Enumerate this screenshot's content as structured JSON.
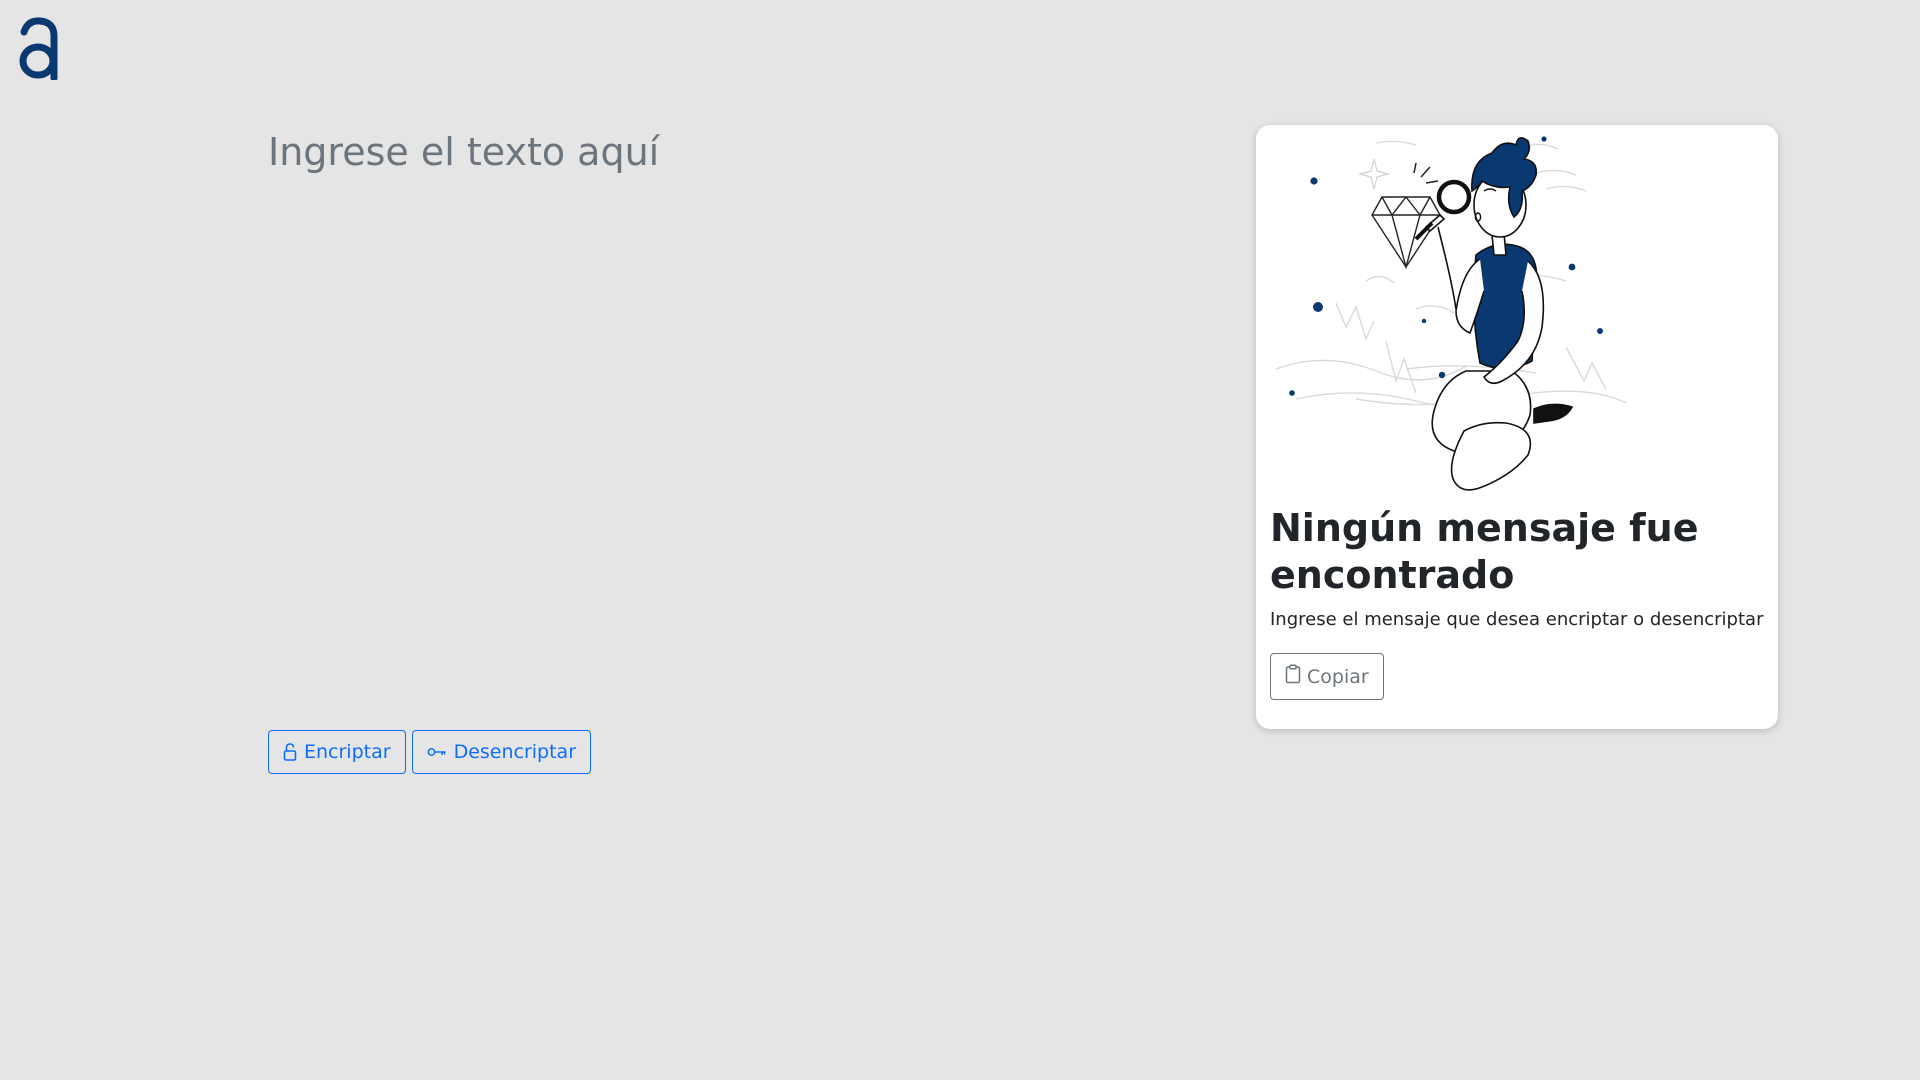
{
  "header": {
    "logo_icon": "alura-logo-icon",
    "logo_color": "#0a3871"
  },
  "input": {
    "placeholder": "Ingrese el texto aquí"
  },
  "actions": {
    "encrypt_label": "Encriptar",
    "encrypt_icon": "lock-icon",
    "decrypt_label": "Desencriptar",
    "decrypt_icon": "key-icon",
    "accent_color": "#0d6efd"
  },
  "result_card": {
    "illustration": "person-with-magnifying-glass-and-diamond",
    "title": "Ningún mensaje fue encontrado",
    "text": "Ingrese el mensaje que desea encriptar o desencriptar",
    "copy_label": "Copiar",
    "copy_icon": "clipboard-icon"
  }
}
